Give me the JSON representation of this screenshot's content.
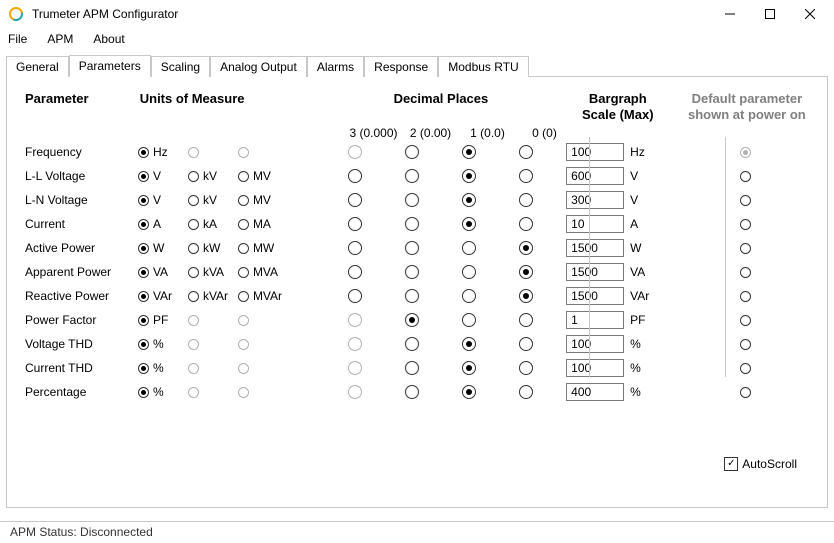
{
  "window": {
    "title": "Trumeter APM Configurator"
  },
  "menu": [
    "File",
    "APM",
    "About"
  ],
  "tabs": [
    "General",
    "Parameters",
    "Scaling",
    "Analog Output",
    "Alarms",
    "Response",
    "Modbus RTU"
  ],
  "active_tab": 1,
  "headers": {
    "param": "Parameter",
    "units": "Units of Measure",
    "dp": "Decimal Places",
    "bar_l1": "Bargraph",
    "bar_l2": "Scale (Max)",
    "def_l1": "Default parameter",
    "def_l2": "shown at power on"
  },
  "dp_labels": [
    "3 (0.000)",
    "2 (0.00)",
    "1 (0.0)",
    "0 (0)"
  ],
  "rows": [
    {
      "name": "Frequency",
      "units": [
        "Hz",
        "",
        ""
      ],
      "unit_sel": 0,
      "unit_enabled": [
        true,
        false,
        false
      ],
      "dp": 2,
      "dp_enabled": [
        false,
        true,
        true,
        true
      ],
      "bar": "100",
      "bar_unit": "Hz",
      "def": true,
      "def_dimmed": true
    },
    {
      "name": "L-L Voltage",
      "units": [
        "V",
        "kV",
        "MV"
      ],
      "unit_sel": 0,
      "unit_enabled": [
        true,
        true,
        true
      ],
      "dp": 2,
      "dp_enabled": [
        true,
        true,
        true,
        true
      ],
      "bar": "600",
      "bar_unit": "V",
      "def": false
    },
    {
      "name": "L-N Voltage",
      "units": [
        "V",
        "kV",
        "MV"
      ],
      "unit_sel": 0,
      "unit_enabled": [
        true,
        true,
        true
      ],
      "dp": 2,
      "dp_enabled": [
        true,
        true,
        true,
        true
      ],
      "bar": "300",
      "bar_unit": "V",
      "def": false
    },
    {
      "name": "Current",
      "units": [
        "A",
        "kA",
        "MA"
      ],
      "unit_sel": 0,
      "unit_enabled": [
        true,
        true,
        true
      ],
      "dp": 2,
      "dp_enabled": [
        true,
        true,
        true,
        true
      ],
      "bar": "10",
      "bar_unit": "A",
      "def": false
    },
    {
      "name": "Active Power",
      "units": [
        "W",
        "kW",
        "MW"
      ],
      "unit_sel": 0,
      "unit_enabled": [
        true,
        true,
        true
      ],
      "dp": 3,
      "dp_enabled": [
        true,
        true,
        true,
        true
      ],
      "bar": "1500",
      "bar_unit": "W",
      "def": false
    },
    {
      "name": "Apparent Power",
      "units": [
        "VA",
        "kVA",
        "MVA"
      ],
      "unit_sel": 0,
      "unit_enabled": [
        true,
        true,
        true
      ],
      "dp": 3,
      "dp_enabled": [
        true,
        true,
        true,
        true
      ],
      "bar": "1500",
      "bar_unit": "VA",
      "def": false
    },
    {
      "name": "Reactive Power",
      "units": [
        "VAr",
        "kVAr",
        "MVAr"
      ],
      "unit_sel": 0,
      "unit_enabled": [
        true,
        true,
        true
      ],
      "dp": 3,
      "dp_enabled": [
        true,
        true,
        true,
        true
      ],
      "bar": "1500",
      "bar_unit": "VAr",
      "def": false
    },
    {
      "name": "Power Factor",
      "units": [
        "PF",
        "",
        ""
      ],
      "unit_sel": 0,
      "unit_enabled": [
        true,
        false,
        false
      ],
      "dp": 1,
      "dp_enabled": [
        false,
        true,
        true,
        true
      ],
      "bar": "1",
      "bar_unit": "PF",
      "def": false
    },
    {
      "name": "Voltage THD",
      "units": [
        "%",
        "",
        ""
      ],
      "unit_sel": 0,
      "unit_enabled": [
        true,
        false,
        false
      ],
      "dp": 2,
      "dp_enabled": [
        false,
        true,
        true,
        true
      ],
      "bar": "100",
      "bar_unit": "%",
      "def": false
    },
    {
      "name": "Current THD",
      "units": [
        "%",
        "",
        ""
      ],
      "unit_sel": 0,
      "unit_enabled": [
        true,
        false,
        false
      ],
      "dp": 2,
      "dp_enabled": [
        false,
        true,
        true,
        true
      ],
      "bar": "100",
      "bar_unit": "%",
      "def": false
    },
    {
      "name": "Percentage",
      "units": [
        "%",
        "",
        ""
      ],
      "unit_sel": 0,
      "unit_enabled": [
        true,
        false,
        false
      ],
      "dp": 2,
      "dp_enabled": [
        false,
        true,
        true,
        true
      ],
      "bar": "400",
      "bar_unit": "%",
      "def": false
    }
  ],
  "autoscroll": {
    "label": "AutoScroll",
    "checked": true
  },
  "status": {
    "label": "APM Status:",
    "value": "Disconnected"
  }
}
